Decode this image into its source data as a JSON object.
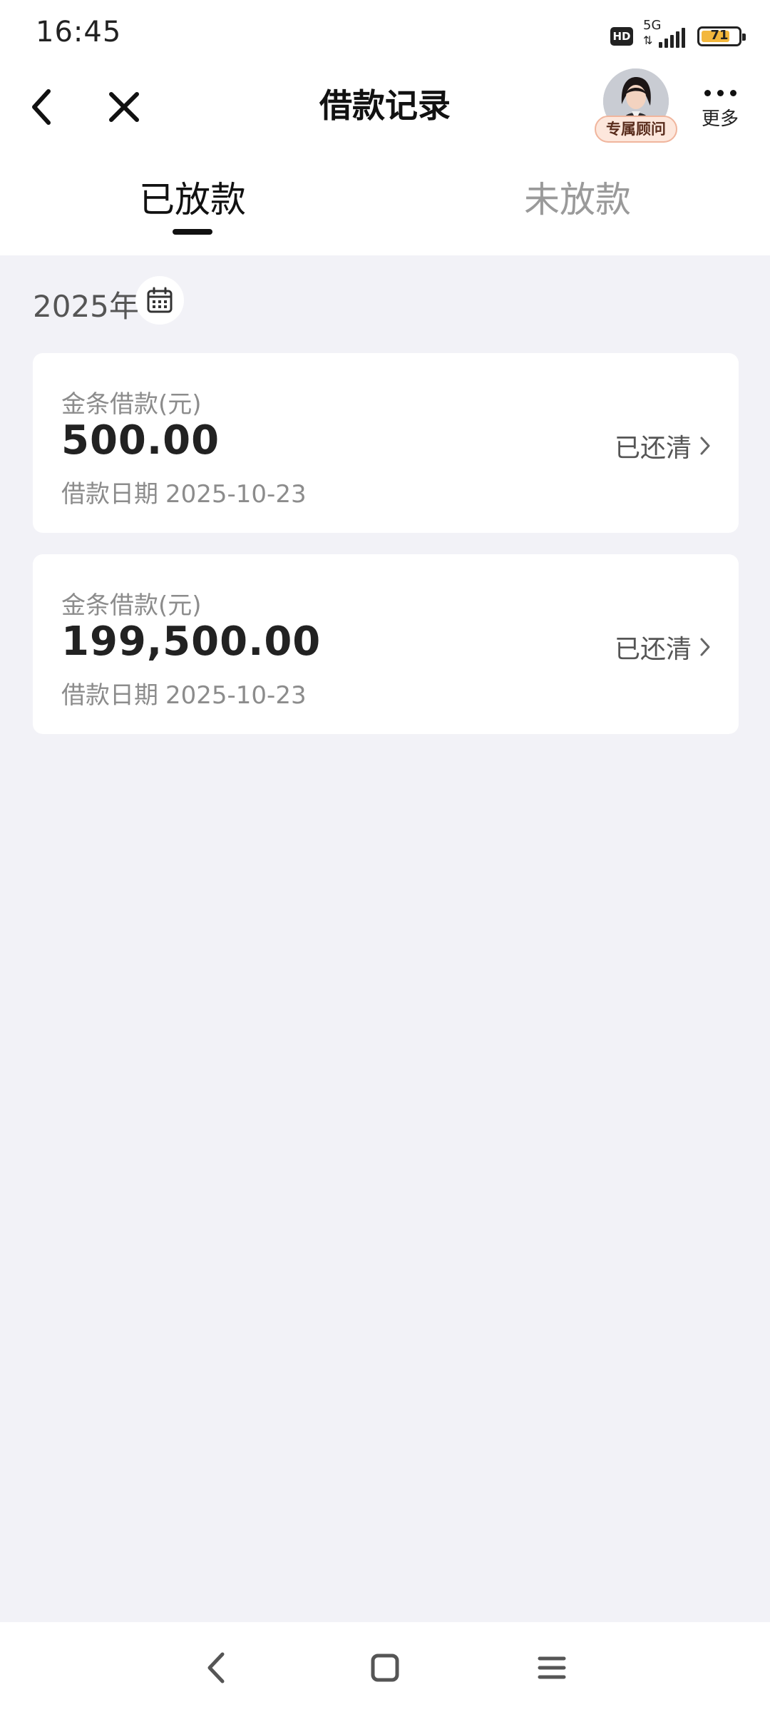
{
  "status_bar": {
    "time": "16:45",
    "hd_label": "HD",
    "network_label": "5G",
    "battery_level": "71",
    "icons": [
      "hd-icon",
      "signal-icon",
      "battery-icon"
    ]
  },
  "header": {
    "title": "借款记录",
    "advisor_label": "专属顾问",
    "more_label": "更多",
    "icons": [
      "back-icon",
      "close-icon",
      "more-icon"
    ]
  },
  "tabs": [
    {
      "label": "已放款",
      "active": true
    },
    {
      "label": "未放款",
      "active": false
    }
  ],
  "filter": {
    "year_label": "2025年",
    "icon": "calendar-icon"
  },
  "loans": [
    {
      "type_label": "金条借款(元)",
      "amount": "500.00",
      "date_label": "借款日期",
      "date_value": "2025-10-23",
      "status": "已还清"
    },
    {
      "type_label": "金条借款(元)",
      "amount": "199,500.00",
      "date_label": "借款日期",
      "date_value": "2025-10-23",
      "status": "已还清"
    }
  ],
  "system_nav": {
    "icons": [
      "nav-back-icon",
      "nav-home-icon",
      "nav-menu-icon"
    ]
  },
  "colors": {
    "page_background": "#f2f2f7",
    "card_background": "#ffffff",
    "advisor_badge": "#fde7dc",
    "battery_fill": "#f3b73c"
  }
}
